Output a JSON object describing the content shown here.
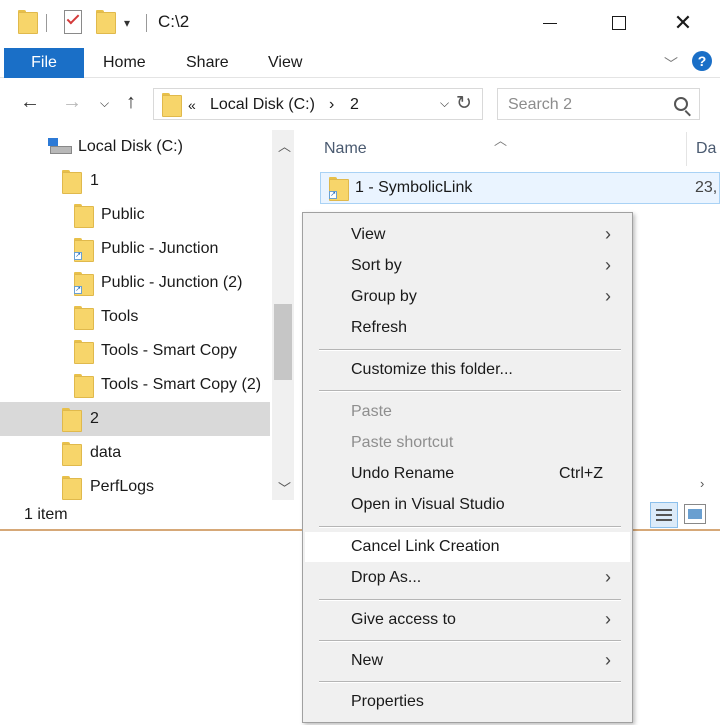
{
  "window": {
    "title": "C:\\2"
  },
  "ribbon": {
    "tabs": [
      "File",
      "Home",
      "Share",
      "View"
    ],
    "help": "?"
  },
  "nav": {
    "address_prefix": "«",
    "address_parts": [
      "Local Disk (C:)",
      "2"
    ],
    "address_sep": "›",
    "search_placeholder": "Search 2"
  },
  "tree": [
    {
      "label": "Local Disk (C:)",
      "icon": "drive-icon"
    },
    {
      "label": "1",
      "icon": "folder-icon"
    },
    {
      "label": "Public",
      "icon": "folder-icon"
    },
    {
      "label": "Public - Junction",
      "icon": "junction-folder-icon"
    },
    {
      "label": "Public - Junction (2)",
      "icon": "junction-folder-icon"
    },
    {
      "label": "Tools",
      "icon": "folder-icon"
    },
    {
      "label": "Tools - Smart Copy",
      "icon": "folder-icon"
    },
    {
      "label": "Tools - Smart Copy (2)",
      "icon": "folder-icon"
    },
    {
      "label": "2",
      "icon": "folder-icon",
      "selected": true
    },
    {
      "label": "data",
      "icon": "folder-icon"
    },
    {
      "label": "PerfLogs",
      "icon": "folder-icon"
    }
  ],
  "content": {
    "columns": [
      "Name",
      "Da"
    ],
    "files": [
      {
        "name": "1 - SymbolicLink",
        "date": "23,"
      }
    ]
  },
  "status": {
    "item_count": "1 item"
  },
  "context_menu": {
    "items": [
      {
        "label": "View",
        "submenu": true
      },
      {
        "label": "Sort by",
        "submenu": true
      },
      {
        "label": "Group by",
        "submenu": true
      },
      {
        "label": "Refresh"
      },
      {
        "label": "Customize this folder..."
      },
      {
        "label": "Paste",
        "disabled": true
      },
      {
        "label": "Paste shortcut",
        "disabled": true
      },
      {
        "label": "Undo Rename",
        "shortcut": "Ctrl+Z"
      },
      {
        "label": "Open in Visual Studio"
      },
      {
        "label": "Cancel Link Creation",
        "hover": true
      },
      {
        "label": "Drop As...",
        "submenu": true
      },
      {
        "label": "Give access to",
        "submenu": true
      },
      {
        "label": "New",
        "submenu": true
      },
      {
        "label": "Properties"
      }
    ]
  },
  "colors": {
    "accent": "#1a6fc7",
    "folder": "#f7d56a",
    "selection": "#d9d9d9",
    "menu_bg": "#f0f0f0"
  }
}
